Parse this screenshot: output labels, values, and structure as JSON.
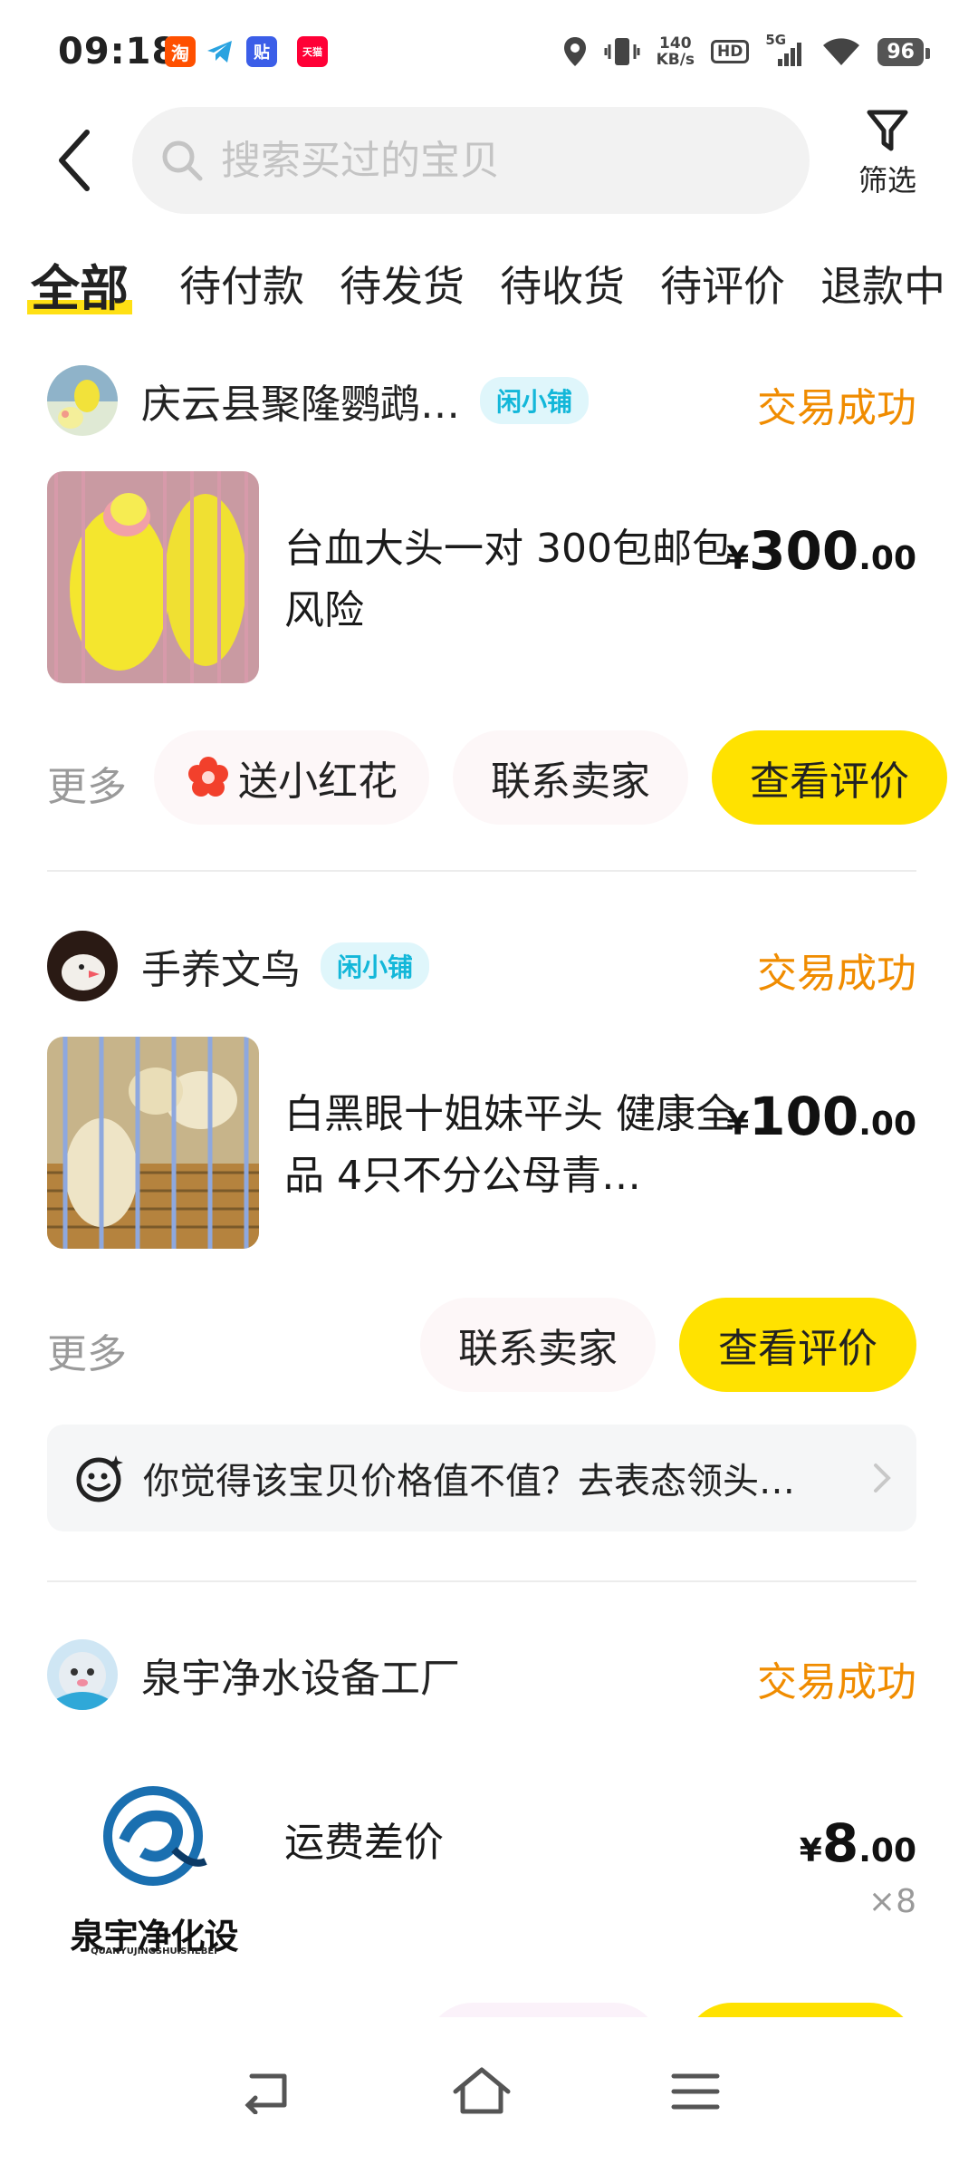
{
  "status_bar": {
    "time": "09:18",
    "app_icons": [
      {
        "name": "taobao-app-icon",
        "glyph": "淘",
        "color": "#ff5000"
      },
      {
        "name": "telegram-app-icon",
        "glyph": "",
        "color": "#2aa3e0"
      },
      {
        "name": "tieba-app-icon",
        "glyph": "贴",
        "color": "#3b5ee8"
      },
      {
        "name": "tmall-app-icon",
        "glyph": "天猫",
        "color": "#ff0036"
      }
    ],
    "network_speed_value": "140",
    "network_speed_unit": "KB/s",
    "hd_label": "HD",
    "signal_label": "5G",
    "battery": "96"
  },
  "header": {
    "search_placeholder": "搜索买过的宝贝",
    "filter_label": "筛选"
  },
  "tabs": [
    {
      "label": "全部",
      "active": true
    },
    {
      "label": "待付款",
      "active": false
    },
    {
      "label": "待发货",
      "active": false
    },
    {
      "label": "待收货",
      "active": false
    },
    {
      "label": "待评价",
      "active": false
    },
    {
      "label": "退款中",
      "active": false
    }
  ],
  "orders": [
    {
      "shop_name": "庆云县聚隆鹦鹉…",
      "shop_badge": "闲小铺",
      "status": "交易成功",
      "title": "台血大头一对 300包邮包风险",
      "price_currency": "¥",
      "price_int": "300",
      "price_dec": ".00",
      "more_label": "更多",
      "action_flower": "送小红花",
      "action_contact": "联系卖家",
      "action_review": "查看评价"
    },
    {
      "shop_name": "手养文鸟",
      "shop_badge": "闲小铺",
      "status": "交易成功",
      "title": "白黑眼十姐妹平头 健康全品 4只不分公母青…",
      "price_currency": "¥",
      "price_int": "100",
      "price_dec": ".00",
      "more_label": "更多",
      "action_contact": "联系卖家",
      "action_review": "查看评价",
      "prompt_text": "你觉得该宝贝价格值不值？去表态领头…"
    },
    {
      "shop_name": "泉宇净水设备工厂",
      "status": "交易成功",
      "title": "运费差价",
      "price_currency": "¥",
      "price_int": "8",
      "price_dec": ".00",
      "quantity": "×8",
      "logo_text": "泉宇净化设备",
      "logo_subtext": "QUANYUJINGSHUISHEBEI"
    }
  ],
  "colors": {
    "accent_yellow": "#ffe200",
    "status_orange": "#f08c00",
    "badge_cyan": "#13b7d9"
  }
}
